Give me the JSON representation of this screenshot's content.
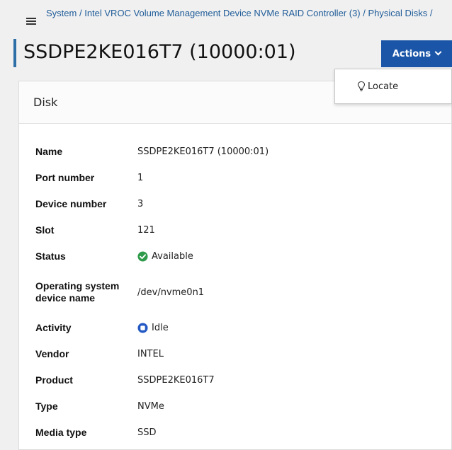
{
  "breadcrumb": {
    "items": [
      "System",
      "Intel VROC Volume Management Device NVMe RAID Controller (3)",
      "Physical Disks"
    ],
    "separator": "/"
  },
  "page_title": "SSDPE2KE016T7 (10000:01)",
  "actions_menu": {
    "button_label": "Actions",
    "items": [
      {
        "label": "Locate",
        "icon": "light-bulb-icon"
      }
    ]
  },
  "card": {
    "title": "Disk",
    "properties": [
      {
        "label": "Name",
        "value": "SSDPE2KE016T7 (10000:01)"
      },
      {
        "label": "Port number",
        "value": "1"
      },
      {
        "label": "Device number",
        "value": "3"
      },
      {
        "label": "Slot",
        "value": "121"
      },
      {
        "label": "Status",
        "value": "Available",
        "icon": "check-circle-icon"
      },
      {
        "label": "Operating system device name",
        "value": "/dev/nvme0n1"
      },
      {
        "label": "Activity",
        "value": "Idle",
        "icon": "idle-circle-icon"
      },
      {
        "label": "Vendor",
        "value": "INTEL"
      },
      {
        "label": "Product",
        "value": "SSDPE2KE016T7"
      },
      {
        "label": "Type",
        "value": "NVMe"
      },
      {
        "label": "Media type",
        "value": "SSD"
      }
    ]
  },
  "colors": {
    "accent": "#1a55a8",
    "link": "#1f5c99",
    "status_ok": "#2e9a4a",
    "activity_idle": "#2459c4"
  }
}
